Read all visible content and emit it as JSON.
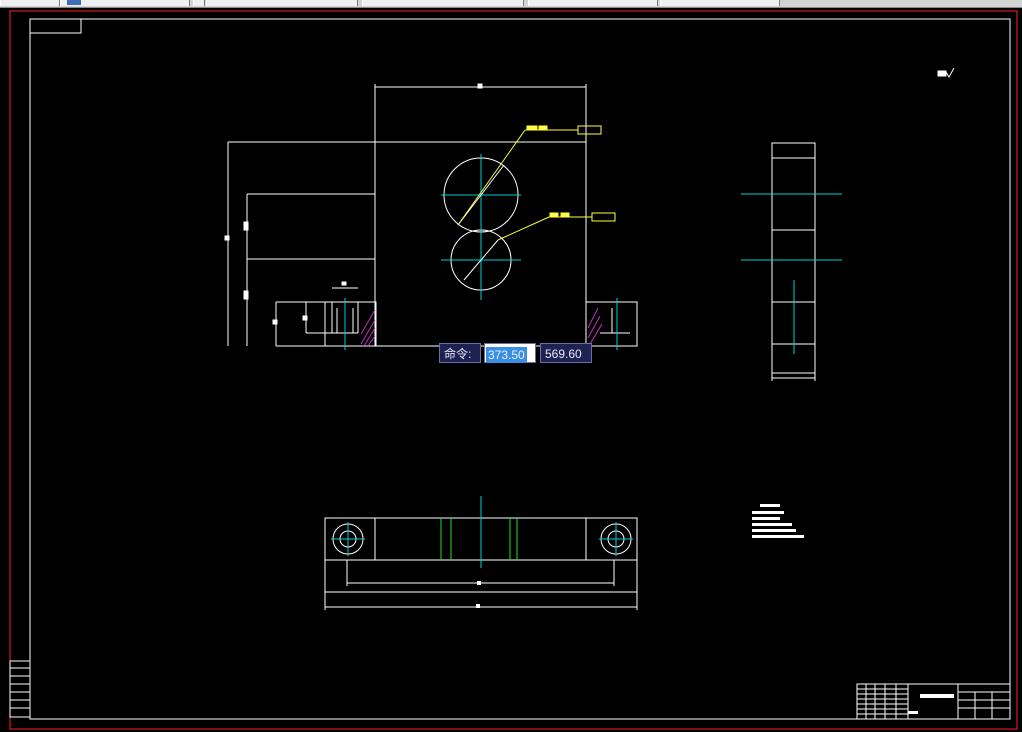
{
  "tabs": [
    {
      "label": ""
    },
    {
      "label": ""
    },
    {
      "label": ""
    },
    {
      "label": ""
    },
    {
      "label": ""
    },
    {
      "label": ""
    },
    {
      "label": ""
    }
  ],
  "command_input": {
    "prompt": "命令:",
    "x_value": "373.50",
    "y_value": "569.60"
  },
  "colors": {
    "background": "#000000",
    "frame_red": "#ff2020",
    "geometry": "#ffffff",
    "centerline": "#00d0d0",
    "leader": "#ffff40",
    "hatch": "#c030c0",
    "green": "#20e020"
  }
}
